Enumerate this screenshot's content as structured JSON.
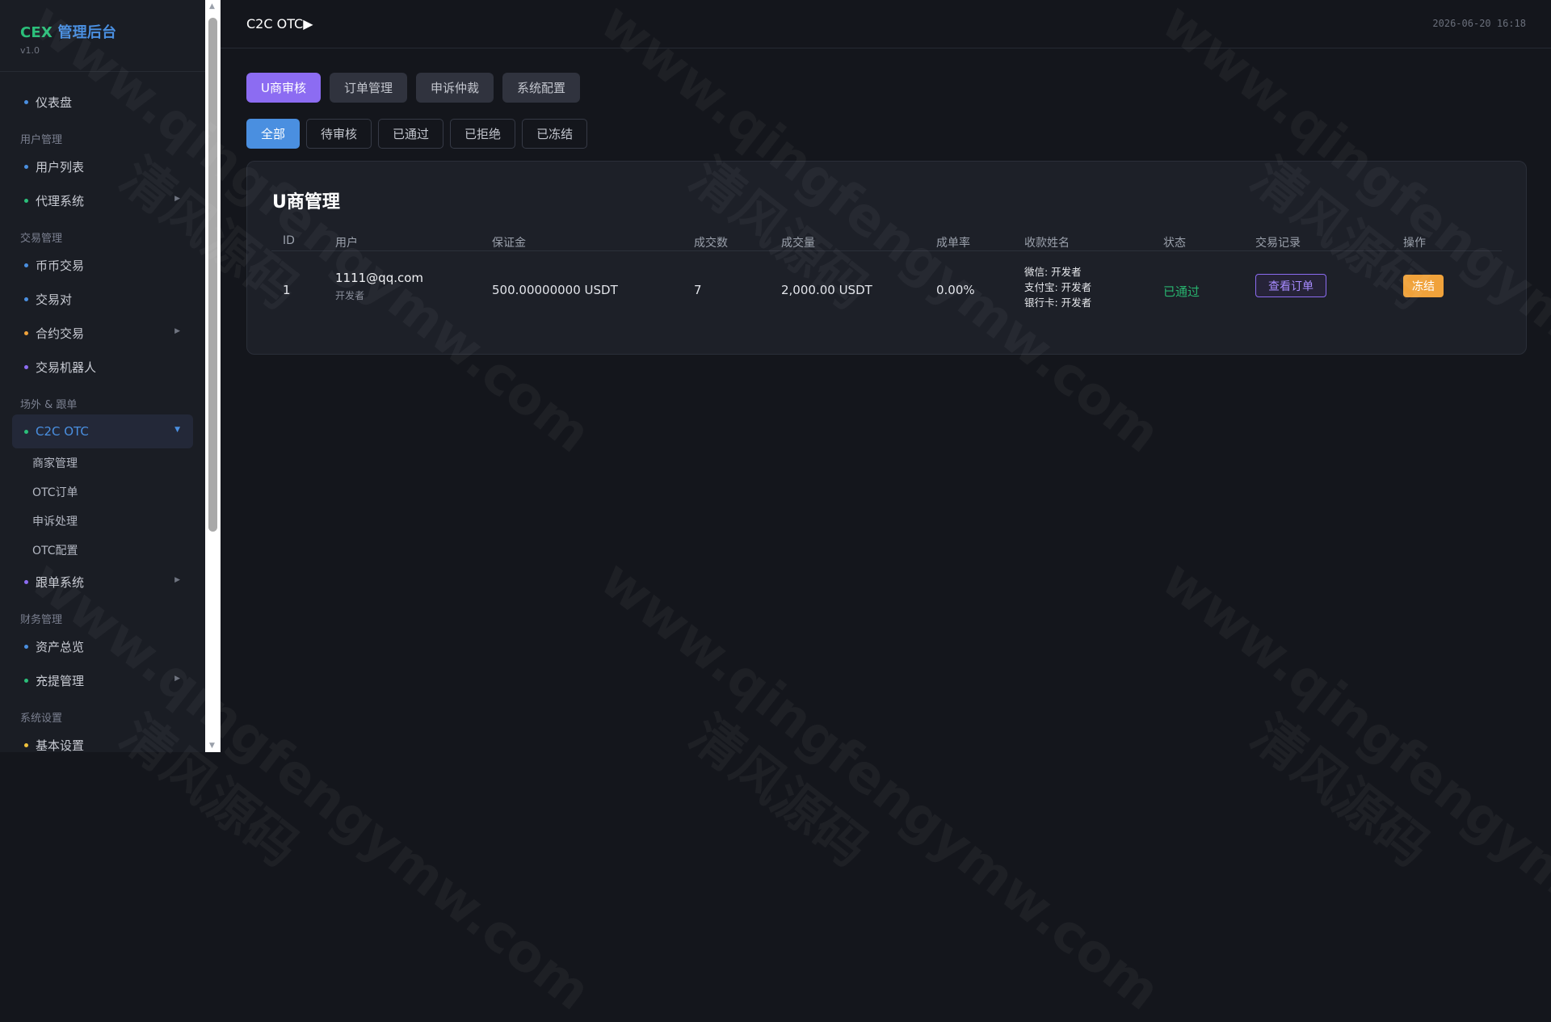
{
  "brand": {
    "prefix": "CEX",
    "title": " 管理后台",
    "version": "v1.0"
  },
  "sidebar": {
    "dashboard": "仪表盘",
    "group_user": "用户管理",
    "user_list": "用户列表",
    "agent": "代理系统",
    "group_trade": "交易管理",
    "coin_trade": "币币交易",
    "pairs": "交易对",
    "contract": "合约交易",
    "bot": "交易机器人",
    "group_otc": "场外 & 跟单",
    "c2c": "C2C OTC",
    "c2c_sub": [
      "商家管理",
      "OTC订单",
      "申诉处理",
      "OTC配置"
    ],
    "copy_trade": "跟单系统",
    "group_finance": "财务管理",
    "assets": "资产总览",
    "deposit": "充提管理",
    "group_system": "系统设置",
    "basic": "基本设置"
  },
  "header": {
    "title": "C2C OTC▶",
    "timestamp": "2026-06-20 16:18"
  },
  "tabs": [
    "U商审核",
    "订单管理",
    "申诉仲裁",
    "系统配置"
  ],
  "filters": [
    "全部",
    "待审核",
    "已通过",
    "已拒绝",
    "已冻结"
  ],
  "card": {
    "title": "U商管理",
    "columns": [
      "ID",
      "用户",
      "保证金",
      "成交数",
      "成交量",
      "成单率",
      "收款姓名",
      "状态",
      "交易记录",
      "操作"
    ],
    "rows": [
      {
        "id": "1",
        "email": "1111@qq.com",
        "nickname": "开发者",
        "deposit": "500.00000000 USDT",
        "count": "7",
        "volume": "2,000.00 USDT",
        "rate": "0.00%",
        "payees": [
          "微信: 开发者",
          "支付宝: 开发者",
          "银行卡: 开发者"
        ],
        "status": "已通过",
        "record_btn": "查看订单",
        "action_btn": "冻结"
      }
    ]
  },
  "watermark": {
    "url": "www.qingfengymw.com",
    "cn": "清风源码"
  },
  "colors": {
    "accent_purple": "#8c6cf2",
    "accent_blue": "#4a8fe0",
    "success": "#28b46f",
    "warning": "#f0a23b",
    "bg": "#14161c"
  }
}
